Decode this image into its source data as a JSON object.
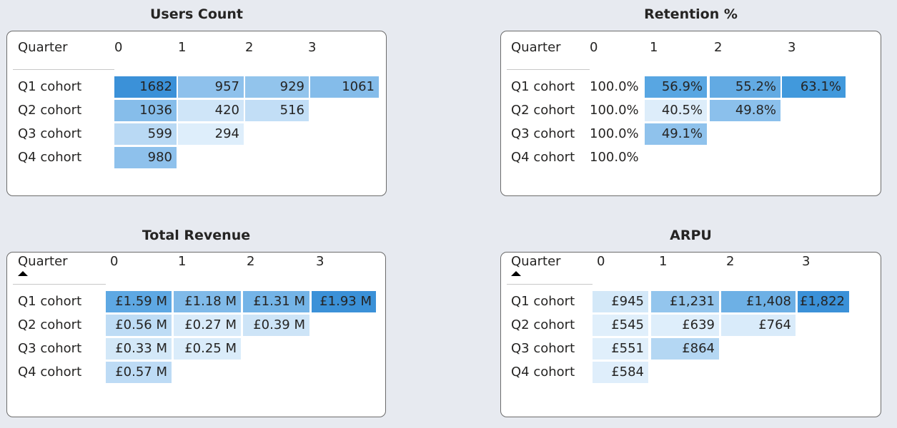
{
  "users": {
    "title": "Users Count",
    "header": {
      "label": "Quarter",
      "cols": [
        "0",
        "1",
        "2",
        "3"
      ]
    },
    "rows": [
      {
        "label": "Q1 cohort",
        "cells": [
          {
            "text": "1682",
            "color": "#3b91d8"
          },
          {
            "text": "957",
            "color": "#8ec1ec"
          },
          {
            "text": "929",
            "color": "#92c4ec"
          },
          {
            "text": "1061",
            "color": "#84bcea"
          }
        ]
      },
      {
        "label": "Q2 cohort",
        "cells": [
          {
            "text": "1036",
            "color": "#86bdea"
          },
          {
            "text": "420",
            "color": "#cfe5f8"
          },
          {
            "text": "516",
            "color": "#c2def6"
          }
        ]
      },
      {
        "label": "Q3 cohort",
        "cells": [
          {
            "text": "599",
            "color": "#b9d9f4"
          },
          {
            "text": "294",
            "color": "#deeefb"
          }
        ]
      },
      {
        "label": "Q4 cohort",
        "cells": [
          {
            "text": "980",
            "color": "#8ec1ec"
          }
        ]
      }
    ]
  },
  "retention": {
    "title": "Retention %",
    "header": {
      "label": "Quarter",
      "cols": [
        "0",
        "1",
        "2",
        "3"
      ]
    },
    "rows": [
      {
        "label": "Q1 cohort",
        "cells": [
          {
            "text": "100.0%",
            "color": ""
          },
          {
            "text": "56.9%",
            "color": "#58a6e2"
          },
          {
            "text": "55.2%",
            "color": "#62aae3"
          },
          {
            "text": "63.1%",
            "color": "#4199dc"
          }
        ]
      },
      {
        "label": "Q2 cohort",
        "cells": [
          {
            "text": "100.0%",
            "color": ""
          },
          {
            "text": "40.5%",
            "color": "#ddedfa"
          },
          {
            "text": "49.8%",
            "color": "#8bc0ec"
          }
        ]
      },
      {
        "label": "Q3 cohort",
        "cells": [
          {
            "text": "100.0%",
            "color": ""
          },
          {
            "text": "49.1%",
            "color": "#8fc2ec"
          }
        ]
      },
      {
        "label": "Q4 cohort",
        "cells": [
          {
            "text": "100.0%",
            "color": ""
          }
        ]
      }
    ]
  },
  "revenue": {
    "title": "Total Revenue",
    "header": {
      "label": "Quarter",
      "cols": [
        "0",
        "1",
        "2",
        "3"
      ]
    },
    "rows": [
      {
        "label": "Q1 cohort",
        "cells": [
          {
            "text": "£1.59 M",
            "color": "#5ea8e3"
          },
          {
            "text": "£1.18 M",
            "color": "#80bae9"
          },
          {
            "text": "£1.31 M",
            "color": "#74b4e7"
          },
          {
            "text": "£1.93 M",
            "color": "#3b91d8"
          }
        ]
      },
      {
        "label": "Q2 cohort",
        "cells": [
          {
            "text": "£0.56 M",
            "color": "#bedcf5"
          },
          {
            "text": "£0.27 M",
            "color": "#d9ebfa"
          },
          {
            "text": "£0.39 M",
            "color": "#cde4f7"
          }
        ]
      },
      {
        "label": "Q3 cohort",
        "cells": [
          {
            "text": "£0.33 M",
            "color": "#d3e8f8"
          },
          {
            "text": "£0.25 M",
            "color": "#daecfa"
          }
        ]
      },
      {
        "label": "Q4 cohort",
        "cells": [
          {
            "text": "£0.57 M",
            "color": "#bddbf5"
          }
        ]
      }
    ]
  },
  "arpu": {
    "title": "ARPU",
    "header": {
      "label": "Quarter",
      "cols": [
        "0",
        "1",
        "2",
        "3"
      ]
    },
    "rows": [
      {
        "label": "Q1 cohort",
        "cells": [
          {
            "text": "£945",
            "color": "#d3e8f8"
          },
          {
            "text": "£1,231",
            "color": "#93c5ed"
          },
          {
            "text": "£1,408",
            "color": "#6db0e5"
          },
          {
            "text": "£1,822",
            "color": "#3b91d8"
          }
        ]
      },
      {
        "label": "Q2 cohort",
        "cells": [
          {
            "text": "£545",
            "color": "#e0effb"
          },
          {
            "text": "£639",
            "color": "#deeefb"
          },
          {
            "text": "£764",
            "color": "#d9ebfa"
          }
        ]
      },
      {
        "label": "Q3 cohort",
        "cells": [
          {
            "text": "£551",
            "color": "#e0effb"
          },
          {
            "text": "£864",
            "color": "#b4d7f3"
          }
        ]
      },
      {
        "label": "Q4 cohort",
        "cells": [
          {
            "text": "£584",
            "color": "#dfeefb"
          }
        ]
      }
    ]
  }
}
